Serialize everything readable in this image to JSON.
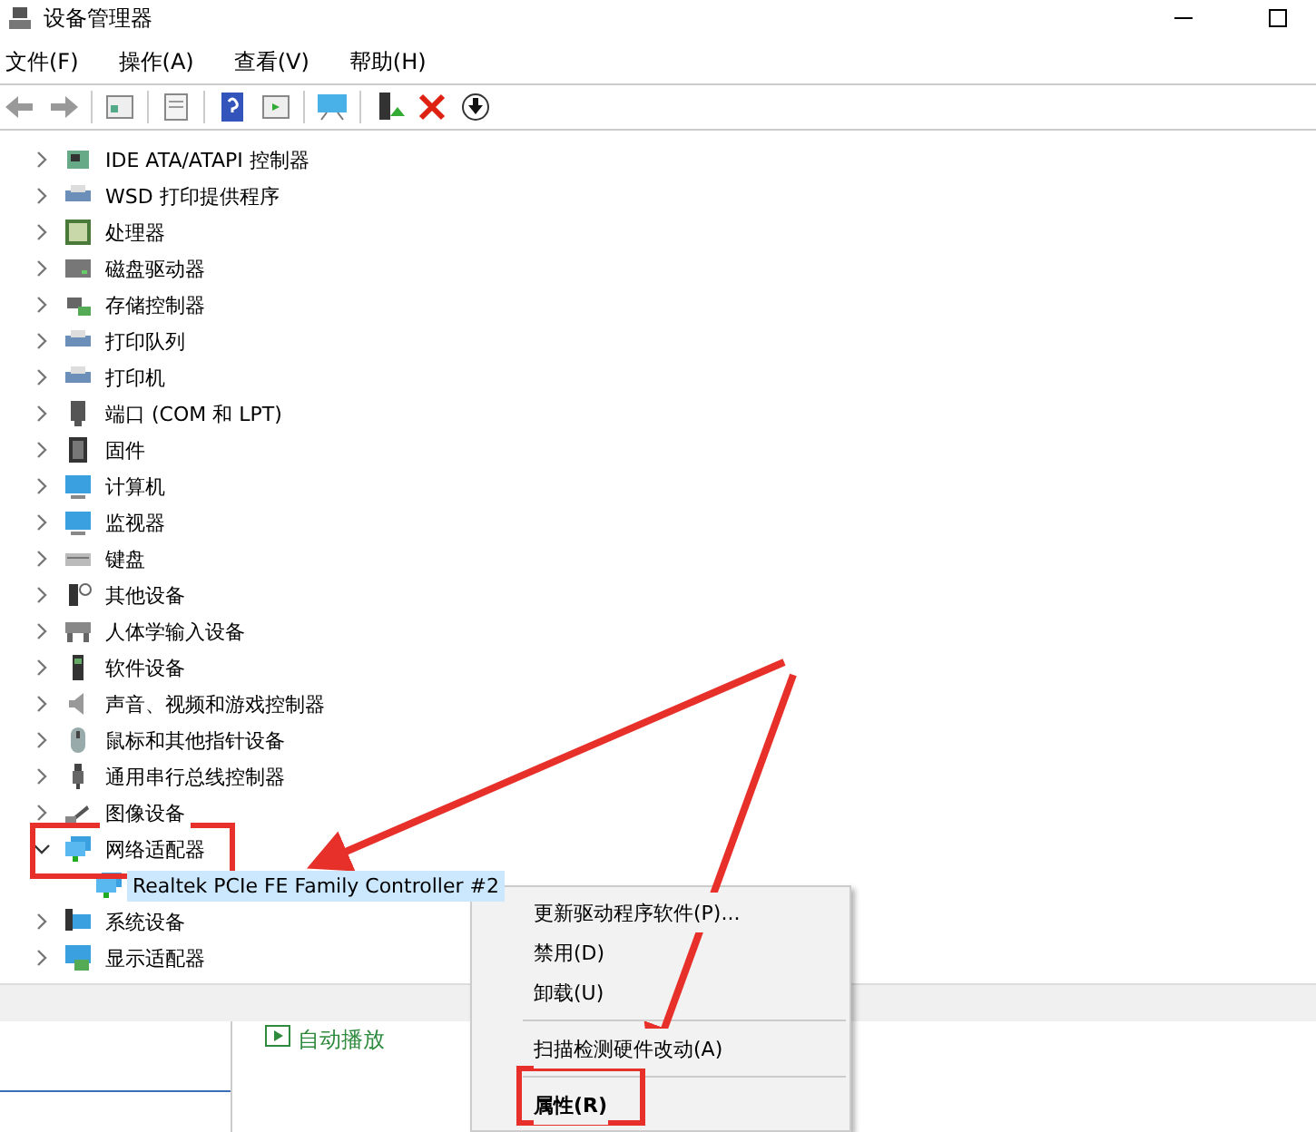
{
  "window": {
    "title": "设备管理器"
  },
  "menu": [
    "文件(F)",
    "操作(A)",
    "查看(V)",
    "帮助(H)"
  ],
  "tree": [
    {
      "label": "IDE ATA/ATAPI 控制器",
      "expanded": false
    },
    {
      "label": "WSD 打印提供程序",
      "expanded": false
    },
    {
      "label": "处理器",
      "expanded": false
    },
    {
      "label": "磁盘驱动器",
      "expanded": false
    },
    {
      "label": "存储控制器",
      "expanded": false
    },
    {
      "label": "打印队列",
      "expanded": false
    },
    {
      "label": "打印机",
      "expanded": false
    },
    {
      "label": "端口 (COM 和 LPT)",
      "expanded": false
    },
    {
      "label": "固件",
      "expanded": false
    },
    {
      "label": "计算机",
      "expanded": false
    },
    {
      "label": "监视器",
      "expanded": false
    },
    {
      "label": "键盘",
      "expanded": false
    },
    {
      "label": "其他设备",
      "expanded": false
    },
    {
      "label": "人体学输入设备",
      "expanded": false
    },
    {
      "label": "软件设备",
      "expanded": false
    },
    {
      "label": "声音、视频和游戏控制器",
      "expanded": false
    },
    {
      "label": "鼠标和其他指针设备",
      "expanded": false
    },
    {
      "label": "通用串行总线控制器",
      "expanded": false
    },
    {
      "label": "图像设备",
      "expanded": false
    },
    {
      "label": "网络适配器",
      "expanded": true,
      "children": [
        {
          "label": "Realtek PCIe FE Family Controller #2",
          "selected": true
        }
      ]
    },
    {
      "label": "系统设备",
      "expanded": false
    },
    {
      "label": "显示适配器",
      "expanded": false
    }
  ],
  "background_panel": {
    "label": "自动播放"
  },
  "context_menu": [
    {
      "label": "更新驱动程序软件(P)...",
      "kind": "item"
    },
    {
      "label": "禁用(D)",
      "kind": "item"
    },
    {
      "label": "卸载(U)",
      "kind": "item"
    },
    {
      "kind": "separator"
    },
    {
      "label": "扫描检测硬件改动(A)",
      "kind": "item"
    },
    {
      "kind": "separator"
    },
    {
      "label": "属性(R)",
      "kind": "default"
    }
  ]
}
